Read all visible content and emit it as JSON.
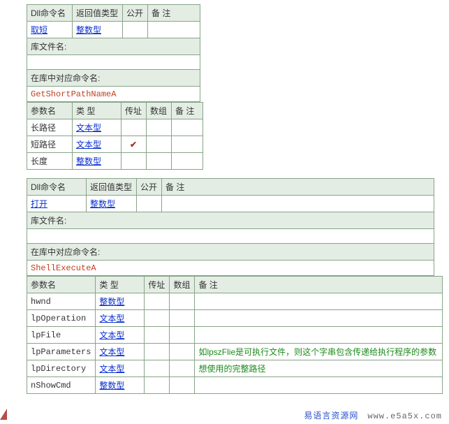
{
  "table1": {
    "headers": {
      "dll_cmd": "Dll命令名",
      "ret_type": "返回值类型",
      "public": "公开",
      "remark": "备 注"
    },
    "row": {
      "name": "取短",
      "ret": "整数型",
      "public": "",
      "remark": ""
    },
    "lib_label": "库文件名:",
    "lib_value": "",
    "inlib_label": "在库中对应命令名:",
    "inlib_value": "GetShortPathNameA",
    "param_headers": {
      "name": "参数名",
      "type": "类 型",
      "byref": "传址",
      "array": "数组",
      "remark": "备 注"
    },
    "params": [
      {
        "name": "长路径",
        "type": "文本型",
        "byref": "",
        "array": "",
        "remark": ""
      },
      {
        "name": "短路径",
        "type": "文本型",
        "byref": "✔",
        "array": "",
        "remark": ""
      },
      {
        "name": "长度",
        "type": "整数型",
        "byref": "",
        "array": "",
        "remark": ""
      }
    ]
  },
  "table2": {
    "headers": {
      "dll_cmd": "Dll命令名",
      "ret_type": "返回值类型",
      "public": "公开",
      "remark": "备 注"
    },
    "row": {
      "name": "打开",
      "ret": "整数型",
      "public": "",
      "remark": ""
    },
    "lib_label": "库文件名:",
    "lib_value": "",
    "inlib_label": "在库中对应命令名:",
    "inlib_value": "ShellExecuteA",
    "param_headers": {
      "name": "参数名",
      "type": "类 型",
      "byref": "传址",
      "array": "数组",
      "remark": "备 注"
    },
    "params": [
      {
        "name": "hwnd",
        "type": "整数型",
        "byref": "",
        "array": "",
        "remark": ""
      },
      {
        "name": "lpOperation",
        "type": "文本型",
        "byref": "",
        "array": "",
        "remark": ""
      },
      {
        "name": "lpFile",
        "type": "文本型",
        "byref": "",
        "array": "",
        "remark": ""
      },
      {
        "name": "lpParameters",
        "type": "文本型",
        "byref": "",
        "array": "",
        "remark": "如lpszFlie是可执行文件，则这个字串包含传递给执行程序的参数"
      },
      {
        "name": "lpDirectory",
        "type": "文本型",
        "byref": "",
        "array": "",
        "remark": "想使用的完整路径"
      },
      {
        "name": "nShowCmd",
        "type": "整数型",
        "byref": "",
        "array": "",
        "remark": ""
      }
    ]
  },
  "watermark": {
    "cn": "易语言资源网",
    "url": "www.e5a5x.com"
  },
  "colw": {
    "t1": {
      "c1": 65,
      "c2": 70,
      "c3": 35,
      "c4": 65
    },
    "t1p": {
      "c1": 65,
      "c2": 70,
      "c3": 35,
      "c4": 35,
      "c5": 45
    },
    "t2": {
      "c1": 85,
      "c2": 70,
      "c3": 35,
      "c4": 380
    },
    "t2p": {
      "c1": 85,
      "c2": 70,
      "c3": 35,
      "c4": 35,
      "c5": 345
    }
  }
}
